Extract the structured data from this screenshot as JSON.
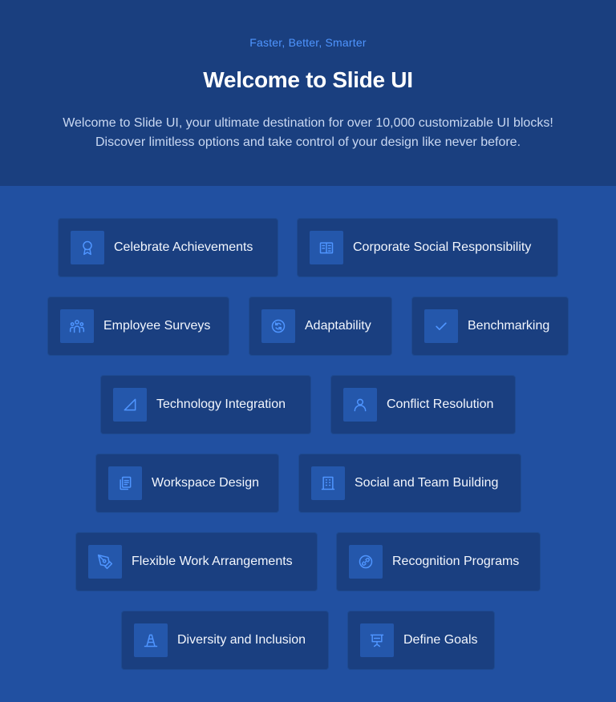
{
  "hero": {
    "eyebrow": "Faster, Better, Smarter",
    "title": "Welcome to Slide UI",
    "description": "Welcome to Slide UI, your ultimate destination for over 10,000 customizable UI blocks! Discover limitless options and take control of your design like never before."
  },
  "colors": {
    "hero_bg": "#1a3f7f",
    "page_bg": "#2150a1",
    "chip_bg": "#1a3f80",
    "icon_tile": "#2457ab",
    "accent": "#4f95ff"
  },
  "features": [
    {
      "label": "Celebrate Achievements",
      "icon": "award-icon"
    },
    {
      "label": "Corporate Social Responsibility",
      "icon": "building-icon"
    },
    {
      "label": "Employee Surveys",
      "icon": "users-icon"
    },
    {
      "label": "Adaptability",
      "icon": "refresh-icon"
    },
    {
      "label": "Benchmarking",
      "icon": "check-icon"
    },
    {
      "label": "Technology Integration",
      "icon": "triangle-ruler-icon"
    },
    {
      "label": "Conflict Resolution",
      "icon": "user-icon"
    },
    {
      "label": "Workspace Design",
      "icon": "copy-icon"
    },
    {
      "label": "Social and Team Building",
      "icon": "office-building-icon"
    },
    {
      "label": "Flexible Work Arrangements",
      "icon": "pen-tool-icon"
    },
    {
      "label": "Recognition Programs",
      "icon": "link-icon"
    },
    {
      "label": "Diversity and Inclusion",
      "icon": "traffic-cone-icon"
    },
    {
      "label": "Define Goals",
      "icon": "presentation-icon"
    }
  ]
}
